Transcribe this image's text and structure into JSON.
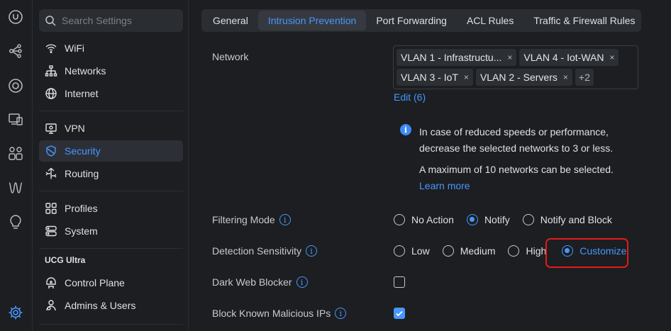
{
  "colors": {
    "accent": "#4797ff",
    "highlight_border": "#e21b1b",
    "background": "#1c1e21"
  },
  "rail": {
    "icons": [
      "unifi-logo-icon",
      "topology-icon",
      "devices-icon",
      "clients-icon",
      "ports-icon",
      "insights-icon",
      "bulb-icon",
      "settings-gear-icon"
    ]
  },
  "sidebar": {
    "search_placeholder": "Search Settings",
    "items": [
      {
        "label": "WiFi",
        "icon": "wifi-icon"
      },
      {
        "label": "Networks",
        "icon": "networks-icon"
      },
      {
        "label": "Internet",
        "icon": "globe-icon"
      },
      {
        "label": "VPN",
        "icon": "vpn-icon"
      },
      {
        "label": "Security",
        "icon": "shield-icon",
        "active": true
      },
      {
        "label": "Routing",
        "icon": "routing-icon"
      },
      {
        "label": "Profiles",
        "icon": "profiles-icon"
      },
      {
        "label": "System",
        "icon": "system-icon"
      }
    ],
    "section_title": "UCG Ultra",
    "section_items": [
      {
        "label": "Control Plane",
        "icon": "control-plane-icon"
      },
      {
        "label": "Admins & Users",
        "icon": "admins-icon"
      }
    ]
  },
  "tabs": [
    {
      "label": "General"
    },
    {
      "label": "Intrusion Prevention",
      "active": true
    },
    {
      "label": "Port Forwarding"
    },
    {
      "label": "ACL Rules"
    },
    {
      "label": "Traffic & Firewall Rules"
    }
  ],
  "network": {
    "label": "Network",
    "chips": [
      "VLAN 1 - Infrastructu...",
      "VLAN 4 - Iot-WAN",
      "VLAN 3 - IoT",
      "VLAN 2 - Servers"
    ],
    "more": "+2",
    "remove_symbol": "×",
    "edit_link": "Edit (6)"
  },
  "notice": {
    "line1": "In case of reduced speeds or performance, decrease the selected networks to 3 or less.",
    "line2": "A maximum of 10 networks can be selected.",
    "learn_more": "Learn more"
  },
  "filtering_mode": {
    "label": "Filtering Mode",
    "options": [
      "No Action",
      "Notify",
      "Notify and Block"
    ],
    "selected": "Notify"
  },
  "detection_sensitivity": {
    "label": "Detection Sensitivity",
    "options": [
      "Low",
      "Medium",
      "High",
      "Customize"
    ],
    "selected": "Customize"
  },
  "dark_web_blocker": {
    "label": "Dark Web Blocker",
    "checked": false
  },
  "block_malicious_ips": {
    "label": "Block Known Malicious IPs",
    "checked": true
  }
}
